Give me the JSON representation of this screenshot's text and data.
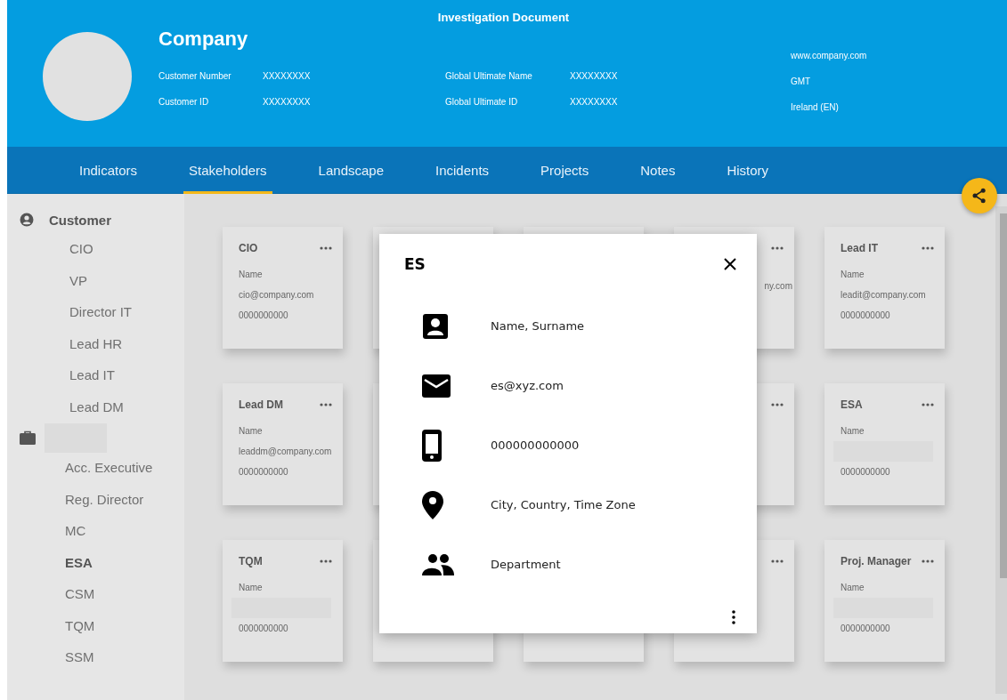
{
  "header": {
    "title": "Investigation Document",
    "company": "Company",
    "fields_left": [
      {
        "label": "Customer Number",
        "value": "XXXXXXXX"
      },
      {
        "label": "Customer ID",
        "value": "XXXXXXXX"
      }
    ],
    "fields_middle": [
      {
        "label": "Global Ultimate Name",
        "value": "XXXXXXXX"
      },
      {
        "label": "Global Ultimate ID",
        "value": "XXXXXXXX"
      }
    ],
    "info_right": [
      "www.company.com",
      "GMT",
      "Ireland (EN)"
    ]
  },
  "tabs": [
    {
      "label": "Indicators",
      "selected": false
    },
    {
      "label": "Stakeholders",
      "selected": true
    },
    {
      "label": "Landscape",
      "selected": false
    },
    {
      "label": "Incidents",
      "selected": false
    },
    {
      "label": "Projects",
      "selected": false
    },
    {
      "label": "Notes",
      "selected": false
    },
    {
      "label": "History",
      "selected": false
    }
  ],
  "sidebar": {
    "groups": [
      {
        "kind": "person",
        "label": "Customer",
        "items": [
          {
            "label": "CIO",
            "selected": false
          },
          {
            "label": "VP",
            "selected": false
          },
          {
            "label": "Director IT",
            "selected": false
          },
          {
            "label": "Lead HR",
            "selected": false
          },
          {
            "label": "Lead IT",
            "selected": false
          },
          {
            "label": "Lead DM",
            "selected": false
          }
        ]
      },
      {
        "kind": "briefcase",
        "items": [
          {
            "label": "Acc. Executive",
            "selected": false
          },
          {
            "label": "Reg. Director",
            "selected": false
          },
          {
            "label": "MC",
            "selected": false
          },
          {
            "label": "ESA",
            "selected": true
          },
          {
            "label": "CSM",
            "selected": false
          },
          {
            "label": "TQM",
            "selected": false
          },
          {
            "label": "SSM",
            "selected": false
          }
        ]
      }
    ]
  },
  "cards": [
    {
      "kind": "full",
      "title": "CIO",
      "lines": [
        {
          "kind": "text",
          "text": "Name"
        },
        {
          "kind": "text",
          "text": "cio@company.com"
        },
        {
          "kind": "text",
          "text": "0000000000"
        }
      ]
    },
    {
      "kind": "covered"
    },
    {
      "kind": "covered"
    },
    {
      "kind": "covered_edge",
      "fragment": "ny.com"
    },
    {
      "kind": "full",
      "title": "Lead IT",
      "lines": [
        {
          "kind": "text",
          "text": "Name"
        },
        {
          "kind": "text",
          "text": "leadit@company.com"
        },
        {
          "kind": "text",
          "text": "0000000000"
        }
      ]
    },
    {
      "kind": "full",
      "title": "Lead DM",
      "lines": [
        {
          "kind": "text",
          "text": "Name"
        },
        {
          "kind": "text",
          "text": "leaddm@company.com"
        },
        {
          "kind": "text",
          "text": "0000000000"
        }
      ]
    },
    {
      "kind": "covered"
    },
    {
      "kind": "covered_edge"
    },
    {
      "kind": "full",
      "title": "ESA",
      "lines": [
        {
          "kind": "text",
          "text": "Name"
        },
        {
          "kind": "blank"
        },
        {
          "kind": "text",
          "text": "0000000000"
        }
      ]
    },
    {
      "kind": "full",
      "title": "TQM",
      "lines": [
        {
          "kind": "text",
          "text": "Name"
        },
        {
          "kind": "blank"
        },
        {
          "kind": "text",
          "text": "0000000000"
        }
      ]
    },
    {
      "kind": "covered"
    },
    {
      "kind": "covered"
    },
    {
      "kind": "covered_edge"
    },
    {
      "kind": "full",
      "title": "Proj. Manager",
      "lines": [
        {
          "kind": "text",
          "text": "Name"
        },
        {
          "kind": "blank"
        },
        {
          "kind": "text",
          "text": "0000000000"
        }
      ]
    }
  ],
  "dialog": {
    "title": "ES",
    "rows": [
      {
        "kind": "person",
        "text": "Name, Surname"
      },
      {
        "kind": "mail",
        "text": "es@xyz.com"
      },
      {
        "kind": "phone",
        "text": "000000000000"
      },
      {
        "kind": "pin",
        "text": "City, Country, Time Zone"
      },
      {
        "kind": "group",
        "text": "Department"
      }
    ]
  }
}
